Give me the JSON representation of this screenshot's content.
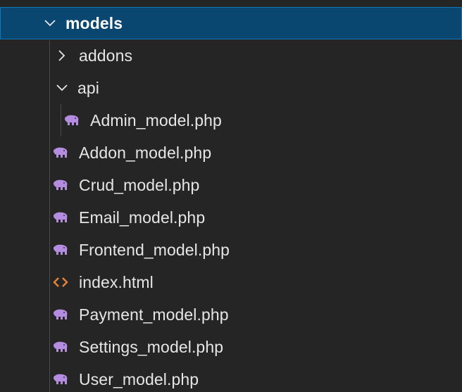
{
  "explorer": {
    "root": {
      "label": "models",
      "icon": "chevron-down-icon"
    },
    "folders": [
      {
        "label": "addons",
        "icon": "chevron-right-icon"
      },
      {
        "label": "api",
        "icon": "chevron-down-icon"
      }
    ],
    "api_children": [
      {
        "label": "Admin_model.php",
        "icon": "php-elephant-icon"
      }
    ],
    "files": [
      {
        "label": "Addon_model.php",
        "icon": "php-elephant-icon"
      },
      {
        "label": "Crud_model.php",
        "icon": "php-elephant-icon"
      },
      {
        "label": "Email_model.php",
        "icon": "php-elephant-icon"
      },
      {
        "label": "Frontend_model.php",
        "icon": "php-elephant-icon"
      },
      {
        "label": "index.html",
        "icon": "html-code-icon"
      },
      {
        "label": "Payment_model.php",
        "icon": "php-elephant-icon"
      },
      {
        "label": "Settings_model.php",
        "icon": "php-elephant-icon"
      },
      {
        "label": "User_model.php",
        "icon": "php-elephant-icon"
      }
    ]
  },
  "colors": {
    "background": "#252526",
    "selection": "#094771",
    "php_icon": "#b48ce0",
    "html_icon": "#e8833a",
    "text": "#e6e6e6"
  }
}
